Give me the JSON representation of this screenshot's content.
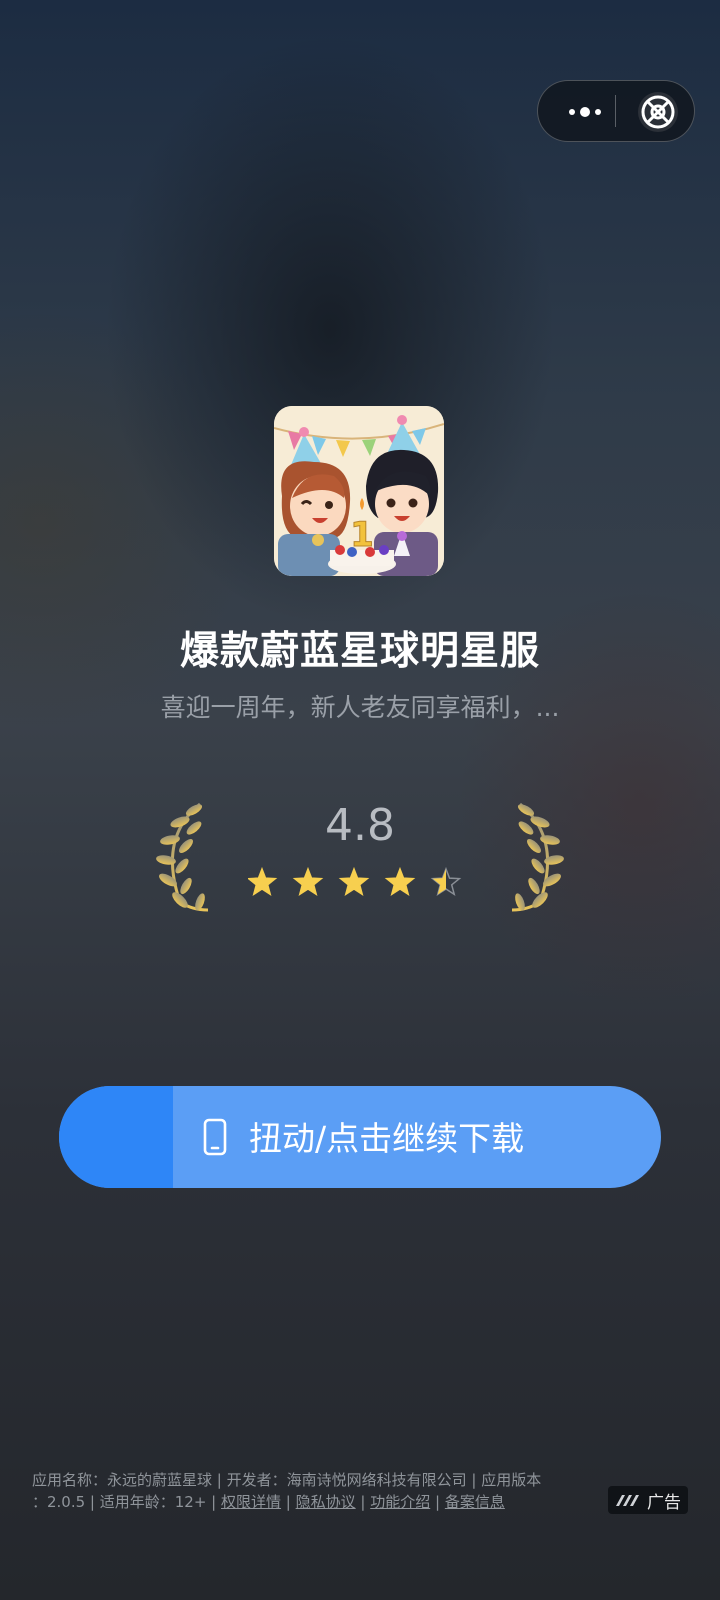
{
  "top_capsule": {
    "more_icon": "more-dots-icon",
    "close_icon": "target-close-icon"
  },
  "app": {
    "icon_name": "app-icon-birthday-characters",
    "icon_badge_digit": "1",
    "title": "爆款蔚蓝星球明星服",
    "subtitle": "喜迎一周年，新人老友同享福利，..."
  },
  "rating": {
    "value": "4.8",
    "stars_filled": 4.5,
    "stars_total": 5,
    "star_color": "#f7cf4f"
  },
  "cta": {
    "label": "扭动/点击继续下载",
    "icon": "phone-icon",
    "progress": 0.19,
    "color_fill": "#5b9ef5",
    "color_progress": "#2e86f7"
  },
  "footer": {
    "app_name_label": "应用名称：",
    "app_name": "永远的蔚蓝星球",
    "sep1": " | ",
    "developer_label": "开发者：",
    "developer": "海南诗悦网络科技有限公司",
    "sep2": " | ",
    "version_label": "应用版本",
    "version_line": "：2.0.5 | 适用年龄：12+ | ",
    "permissions_link": "权限详情",
    "sep3": " | ",
    "privacy_link": "隐私协议",
    "sep4": " | ",
    "features_link": "功能介绍",
    "sep5": " | ",
    "record_link": "备案信息"
  },
  "ad_badge": {
    "label": "广告",
    "icon": "ad-logo-icon"
  }
}
